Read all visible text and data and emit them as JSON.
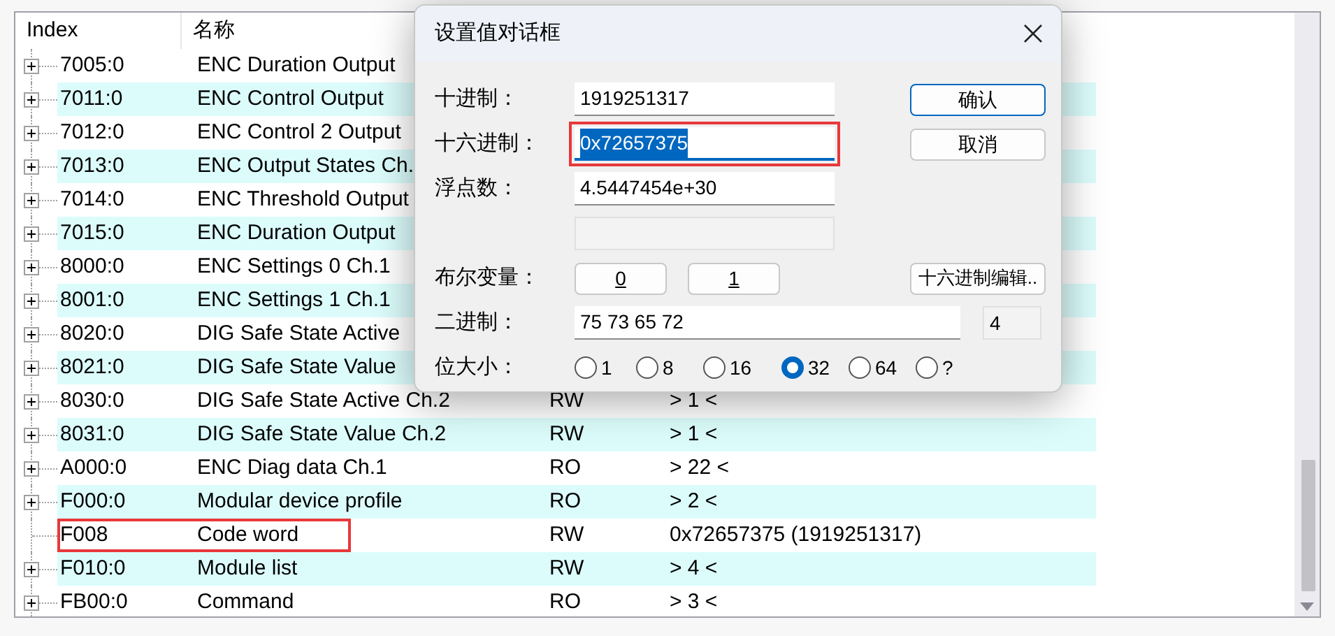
{
  "table": {
    "columns": [
      "Index",
      "名称"
    ],
    "rows": [
      {
        "index": "7005:0",
        "name": "ENC Duration Output",
        "expandable": true,
        "annotated": false
      },
      {
        "index": "7011:0",
        "name": "ENC Control Output",
        "expandable": true,
        "annotated": false
      },
      {
        "index": "7012:0",
        "name": "ENC Control 2 Output",
        "expandable": true,
        "annotated": false
      },
      {
        "index": "7013:0",
        "name": "ENC Output States Ch.",
        "expandable": true,
        "annotated": false
      },
      {
        "index": "7014:0",
        "name": "ENC Threshold Output",
        "expandable": true,
        "annotated": false
      },
      {
        "index": "7015:0",
        "name": "ENC Duration Output",
        "expandable": true,
        "annotated": false
      },
      {
        "index": "8000:0",
        "name": "ENC Settings 0 Ch.1",
        "expandable": true,
        "annotated": false
      },
      {
        "index": "8001:0",
        "name": "ENC Settings 1 Ch.1",
        "expandable": true,
        "annotated": false
      },
      {
        "index": "8020:0",
        "name": "DIG Safe State Active",
        "expandable": true,
        "annotated": false
      },
      {
        "index": "8021:0",
        "name": "DIG Safe State Value",
        "expandable": true,
        "annotated": false
      },
      {
        "index": "8030:0",
        "name": "DIG Safe State Active Ch.2",
        "access": "RW",
        "value": "> 1 <",
        "expandable": true,
        "annotated": false
      },
      {
        "index": "8031:0",
        "name": "DIG Safe State Value Ch.2",
        "access": "RW",
        "value": "> 1 <",
        "expandable": true,
        "annotated": false
      },
      {
        "index": "A000:0",
        "name": "ENC Diag data Ch.1",
        "access": "RO",
        "value": "> 22 <",
        "expandable": true,
        "annotated": false
      },
      {
        "index": "F000:0",
        "name": "Modular device profile",
        "access": "RO",
        "value": "> 2 <",
        "expandable": true,
        "annotated": false
      },
      {
        "index": "F008",
        "name": "Code word",
        "access": "RW",
        "value": "0x72657375 (1919251317)",
        "expandable": false,
        "annotated": true
      },
      {
        "index": "F010:0",
        "name": "Module list",
        "access": "RW",
        "value": "> 4 <",
        "expandable": true,
        "annotated": false
      },
      {
        "index": "FB00:0",
        "name": "Command",
        "access": "RO",
        "value": "> 3 <",
        "expandable": true,
        "annotated": false
      }
    ]
  },
  "dialog": {
    "title": "设置值对话框",
    "fields": [
      {
        "label": "十进制：",
        "value": "1919251317",
        "selected": false,
        "annotated": false
      },
      {
        "label": "十六进制：",
        "value": "0x72657375",
        "selected": true,
        "annotated": true
      },
      {
        "label": "浮点数：",
        "value": "4.5447454e+30",
        "selected": false,
        "annotated": false
      }
    ],
    "extra_field": {
      "disabled": true
    },
    "bool_label": "布尔变量：",
    "bool_buttons": [
      "0",
      "1"
    ],
    "hex_edit_button": "十六进制编辑..",
    "binary": {
      "label": "二进制：",
      "value": "75 73 65 72",
      "count": "4"
    },
    "bitsize": {
      "label": "位大小：",
      "options": [
        {
          "label": "1",
          "selected": false
        },
        {
          "label": "8",
          "selected": false
        },
        {
          "label": "16",
          "selected": false
        },
        {
          "label": "32",
          "selected": true
        },
        {
          "label": "64",
          "selected": false
        },
        {
          "label": "?",
          "selected": false
        }
      ]
    },
    "buttons": [
      {
        "label": "确认",
        "default": true
      },
      {
        "label": "取消",
        "default": false
      }
    ]
  }
}
